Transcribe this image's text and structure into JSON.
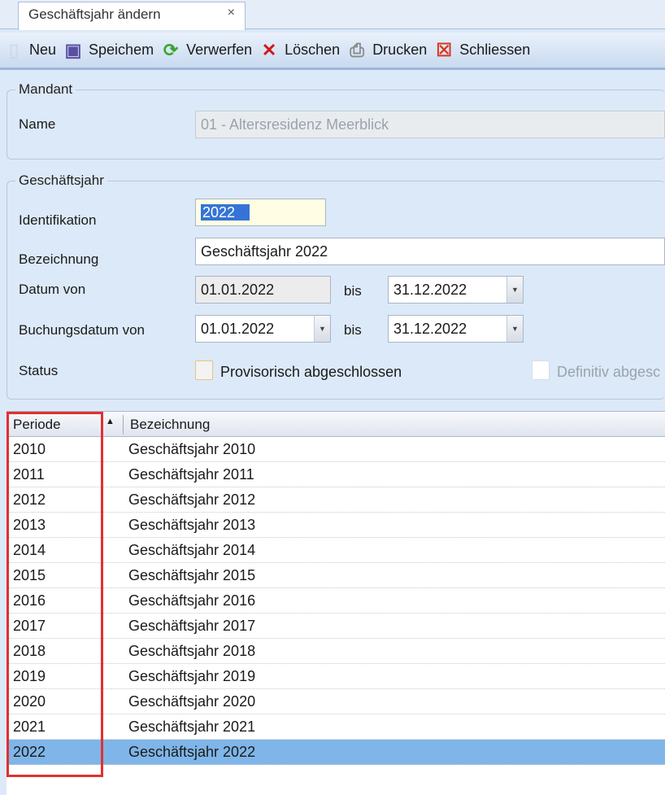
{
  "tab": {
    "title": "Geschäftsjahr ändern",
    "close": "×"
  },
  "toolbar": [
    {
      "label": "Neu",
      "icon": "new-document-icon"
    },
    {
      "label": "Speichem",
      "icon": "floppy-disk-icon"
    },
    {
      "label": "Verwerfen",
      "icon": "discard-arrows-icon"
    },
    {
      "label": "Löschen",
      "icon": "red-x-icon"
    },
    {
      "label": "Drucken",
      "icon": "printer-icon"
    },
    {
      "label": "Schliessen",
      "icon": "close-box-icon"
    }
  ],
  "mandant": {
    "legend": "Mandant",
    "name_label": "Name",
    "name_value": "01 - Altersresidenz Meerblick"
  },
  "gj": {
    "legend": "Geschäftsjahr",
    "ident_label": "Identifikation",
    "ident_value": "2022",
    "bez_label": "Bezeichnung",
    "bez_value": "Geschäftsjahr 2022",
    "datum_label": "Datum von",
    "datum_von": "01.01.2022",
    "bis1": "bis",
    "datum_bis": "31.12.2022",
    "buch_label": "Buchungsdatum von",
    "buch_von": "01.01.2022",
    "bis2": "bis",
    "buch_bis": "31.12.2022",
    "status_label": "Status",
    "prov_label": "Provisorisch abgeschlossen",
    "def_label": "Definitiv abgesc"
  },
  "grid": {
    "columns": [
      "Periode",
      "Bezeichnung"
    ],
    "sort_icon": "▲",
    "selected": "2022",
    "rows": [
      [
        "2010",
        "Geschäftsjahr 2010"
      ],
      [
        "2011",
        "Geschäftsjahr 2011"
      ],
      [
        "2012",
        "Geschäftsjahr 2012"
      ],
      [
        "2013",
        "Geschäftsjahr 2013"
      ],
      [
        "2014",
        "Geschäftsjahr 2014"
      ],
      [
        "2015",
        "Geschäftsjahr 2015"
      ],
      [
        "2016",
        "Geschäftsjahr 2016"
      ],
      [
        "2017",
        "Geschäftsjahr 2017"
      ],
      [
        "2018",
        "Geschäftsjahr 2018"
      ],
      [
        "2019",
        "Geschäftsjahr 2019"
      ],
      [
        "2020",
        "Geschäftsjahr 2020"
      ],
      [
        "2021",
        "Geschäftsjahr 2021"
      ],
      [
        "2022",
        "Geschäftsjahr 2022"
      ]
    ]
  },
  "colors": {
    "highlight": "#e23030",
    "selection": "#7fb5e8"
  }
}
